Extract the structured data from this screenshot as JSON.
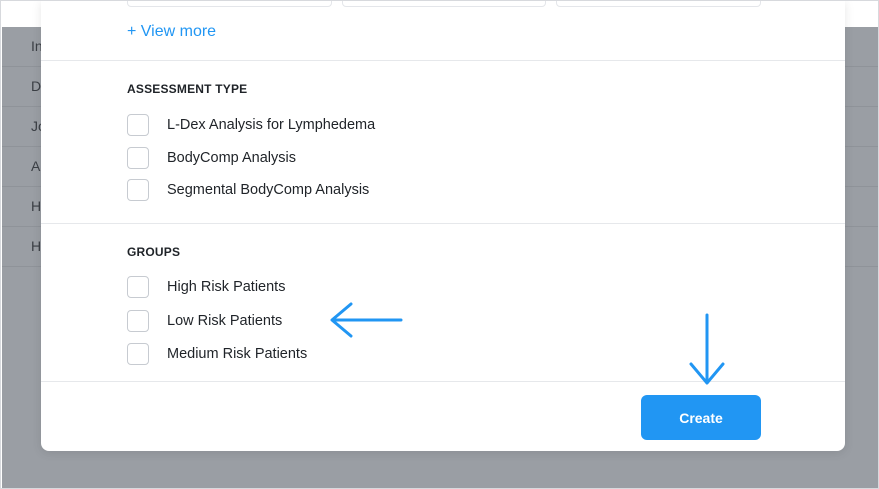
{
  "background": {
    "rows": [
      "In",
      "D",
      "Jo",
      "A",
      "H",
      "H"
    ]
  },
  "view_more": "+ View more",
  "assessment": {
    "title": "ASSESSMENT TYPE",
    "options": [
      "L-Dex Analysis for Lymphedema",
      "BodyComp Analysis",
      "Segmental BodyComp Analysis"
    ]
  },
  "groups": {
    "title": "GROUPS",
    "options": [
      "High Risk Patients",
      "Low Risk Patients",
      "Medium Risk Patients"
    ]
  },
  "create_label": "Create",
  "colors": {
    "accent": "#2196f3",
    "overlay": "#9a9ea4"
  },
  "annotations": [
    "left-arrow-icon",
    "down-arrow-icon"
  ]
}
